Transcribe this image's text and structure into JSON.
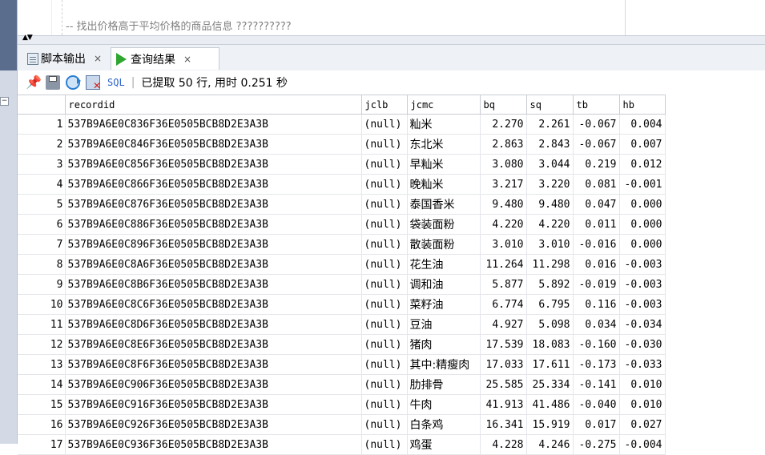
{
  "editor": {
    "comment": "-- 找出价格高于平均价格的商品信息 ??????????"
  },
  "splitter": {
    "arrows": "▲▼"
  },
  "tabs": [
    {
      "label": "脚本输出",
      "close": "×"
    },
    {
      "label": "查询结果",
      "close": "×"
    }
  ],
  "toolbar": {
    "sql_label": "SQL",
    "separator": "|",
    "status": "已提取 50 行, 用时 0.251 秒"
  },
  "grid": {
    "columns": [
      "recordid",
      "jclb",
      "jcmc",
      "bq",
      "sq",
      "tb",
      "hb"
    ],
    "rows": [
      [
        "1",
        "537B9A6E0C836F36E0505BCB8D2E3A3B",
        "(null)",
        "籼米",
        "2.270",
        "2.261",
        "-0.067",
        "0.004"
      ],
      [
        "2",
        "537B9A6E0C846F36E0505BCB8D2E3A3B",
        "(null)",
        "东北米",
        "2.863",
        "2.843",
        "-0.067",
        "0.007"
      ],
      [
        "3",
        "537B9A6E0C856F36E0505BCB8D2E3A3B",
        "(null)",
        "早籼米",
        "3.080",
        "3.044",
        "0.219",
        "0.012"
      ],
      [
        "4",
        "537B9A6E0C866F36E0505BCB8D2E3A3B",
        "(null)",
        "晚籼米",
        "3.217",
        "3.220",
        "0.081",
        "-0.001"
      ],
      [
        "5",
        "537B9A6E0C876F36E0505BCB8D2E3A3B",
        "(null)",
        "泰国香米",
        "9.480",
        "9.480",
        "0.047",
        "0.000"
      ],
      [
        "6",
        "537B9A6E0C886F36E0505BCB8D2E3A3B",
        "(null)",
        "袋装面粉",
        "4.220",
        "4.220",
        "0.011",
        "0.000"
      ],
      [
        "7",
        "537B9A6E0C896F36E0505BCB8D2E3A3B",
        "(null)",
        "散装面粉",
        "3.010",
        "3.010",
        "-0.016",
        "0.000"
      ],
      [
        "8",
        "537B9A6E0C8A6F36E0505BCB8D2E3A3B",
        "(null)",
        "花生油",
        "11.264",
        "11.298",
        "0.016",
        "-0.003"
      ],
      [
        "9",
        "537B9A6E0C8B6F36E0505BCB8D2E3A3B",
        "(null)",
        "调和油",
        "5.877",
        "5.892",
        "-0.019",
        "-0.003"
      ],
      [
        "10",
        "537B9A6E0C8C6F36E0505BCB8D2E3A3B",
        "(null)",
        "菜籽油",
        "6.774",
        "6.795",
        "0.116",
        "-0.003"
      ],
      [
        "11",
        "537B9A6E0C8D6F36E0505BCB8D2E3A3B",
        "(null)",
        "豆油",
        "4.927",
        "5.098",
        "0.034",
        "-0.034"
      ],
      [
        "12",
        "537B9A6E0C8E6F36E0505BCB8D2E3A3B",
        "(null)",
        "猪肉",
        "17.539",
        "18.083",
        "-0.160",
        "-0.030"
      ],
      [
        "13",
        "537B9A6E0C8F6F36E0505BCB8D2E3A3B",
        "(null)",
        "其中:精瘦肉",
        "17.033",
        "17.611",
        "-0.173",
        "-0.033"
      ],
      [
        "14",
        "537B9A6E0C906F36E0505BCB8D2E3A3B",
        "(null)",
        "肋排骨",
        "25.585",
        "25.334",
        "-0.141",
        "0.010"
      ],
      [
        "15",
        "537B9A6E0C916F36E0505BCB8D2E3A3B",
        "(null)",
        "牛肉",
        "41.913",
        "41.486",
        "-0.040",
        "0.010"
      ],
      [
        "16",
        "537B9A6E0C926F36E0505BCB8D2E3A3B",
        "(null)",
        "白条鸡",
        "16.341",
        "15.919",
        "0.017",
        "0.027"
      ],
      [
        "17",
        "537B9A6E0C936F36E0505BCB8D2E3A3B",
        "(null)",
        "鸡蛋",
        "4.228",
        "4.246",
        "-0.275",
        "-0.004"
      ]
    ]
  }
}
